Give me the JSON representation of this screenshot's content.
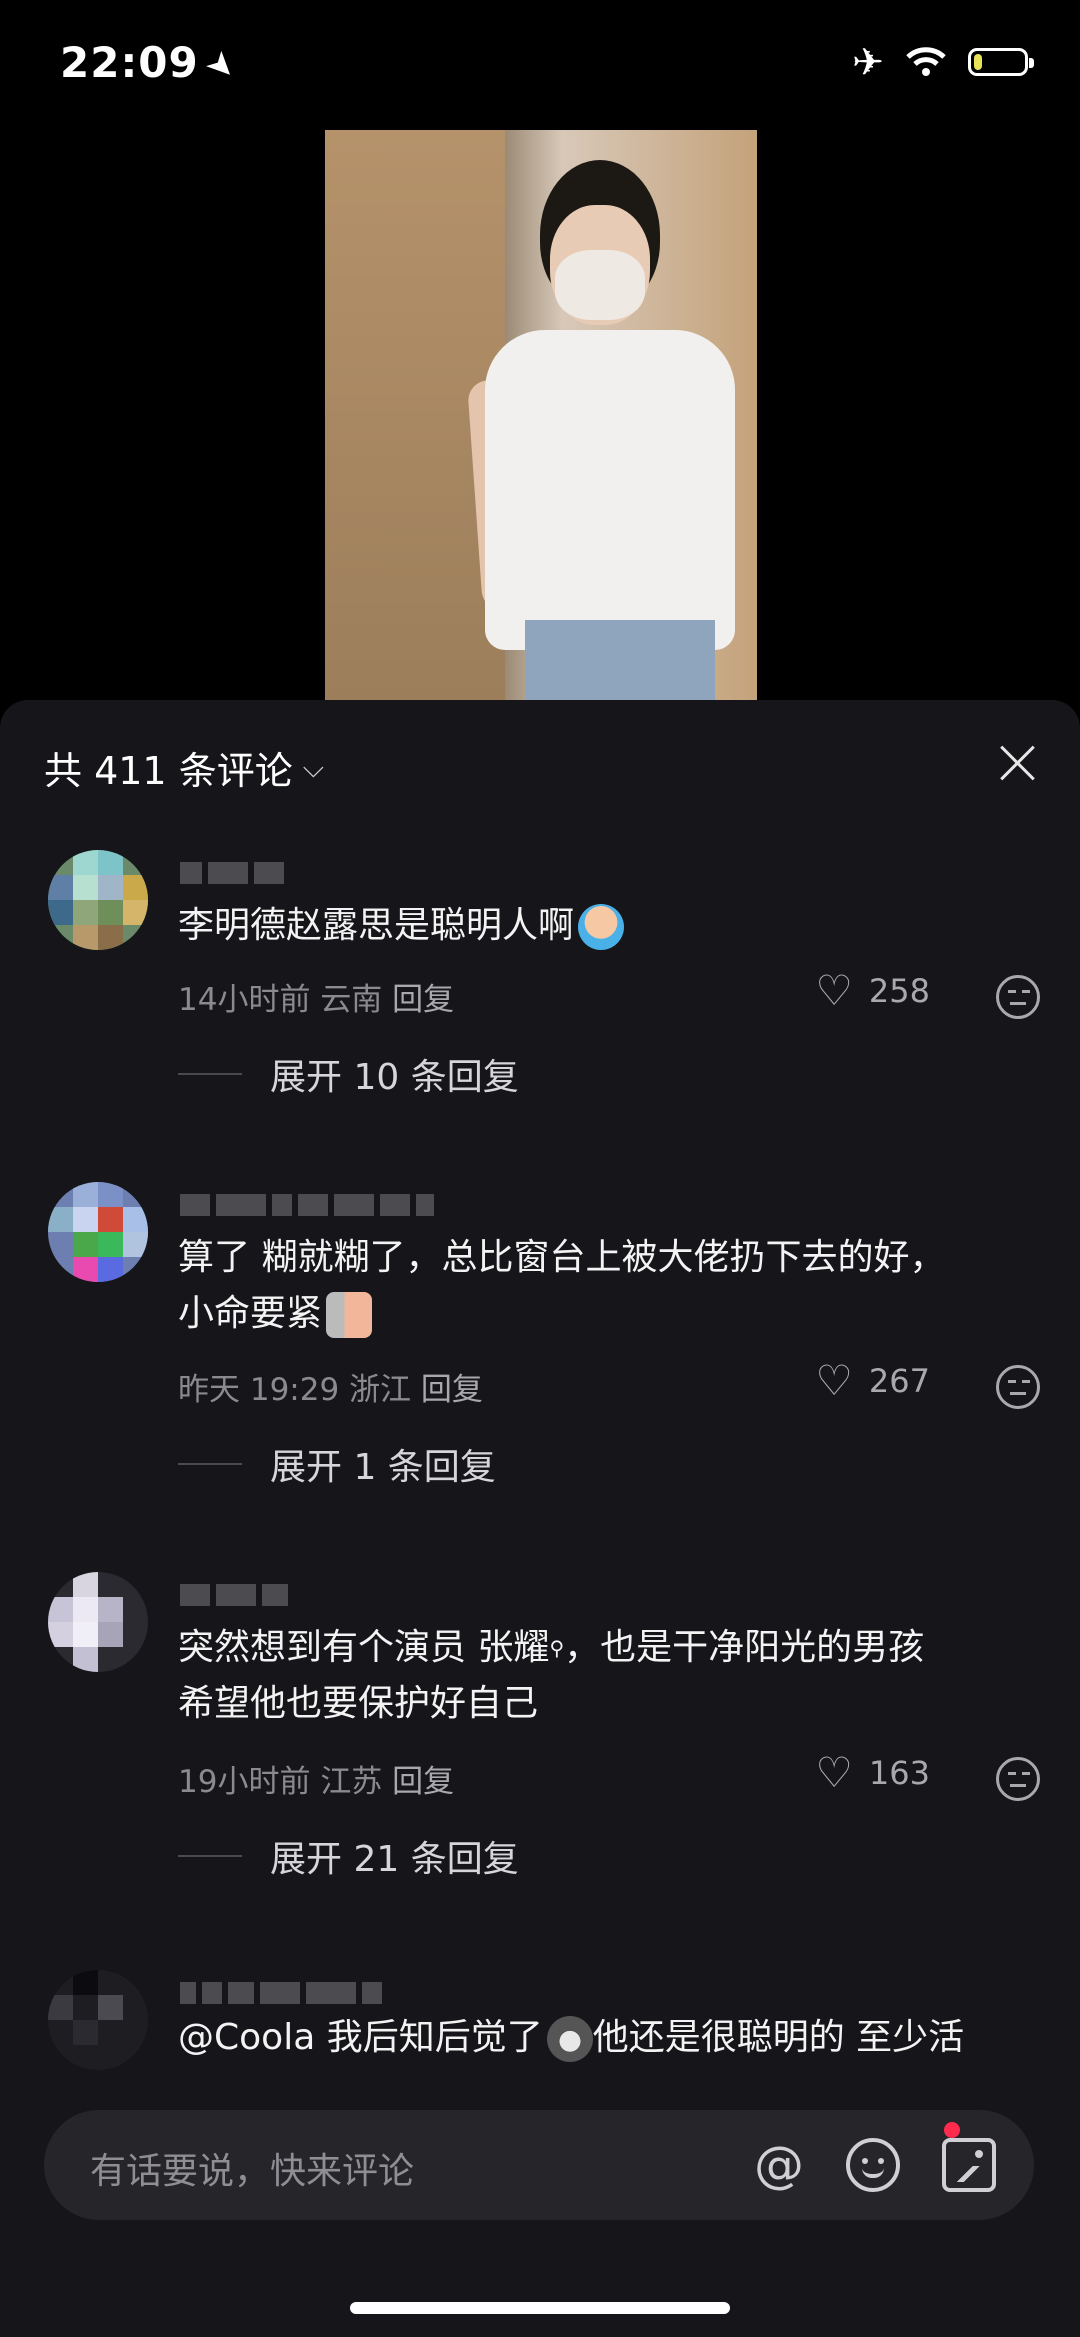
{
  "status_bar": {
    "time": "22:09",
    "battery_color": "#e8e25a"
  },
  "video": {},
  "comments_panel": {
    "count_label": "共 411 条评论",
    "comments": [
      {
        "text": "李明德赵露思是聪明人啊",
        "time": "14小时前",
        "location": "云南",
        "reply_label": "回复",
        "likes": "258",
        "expand_label": "展开 10 条回复"
      },
      {
        "text_line1": "算了 糊就糊了，总比窗台上被大佬扔下去的好，",
        "text_line2": "小命要紧",
        "time": "昨天 19:29",
        "location": "浙江",
        "reply_label": "回复",
        "likes": "267",
        "expand_label": "展开 1 条回复"
      },
      {
        "text_line1": "突然想到有个演员 张耀",
        "text_line1_tail": "，也是干净阳光的男孩",
        "text_line2": "希望他也要保护好自己",
        "time": "19小时前",
        "location": "江苏",
        "reply_label": "回复",
        "likes": "163",
        "expand_label": "展开 21 条回复"
      },
      {
        "text_part1": "@Coola 我后知后觉了",
        "text_part2": "他还是很聪明的 至少活"
      }
    ]
  },
  "input_bar": {
    "placeholder": "有话要说，快来评论",
    "notification_color": "#ff2b4f"
  }
}
